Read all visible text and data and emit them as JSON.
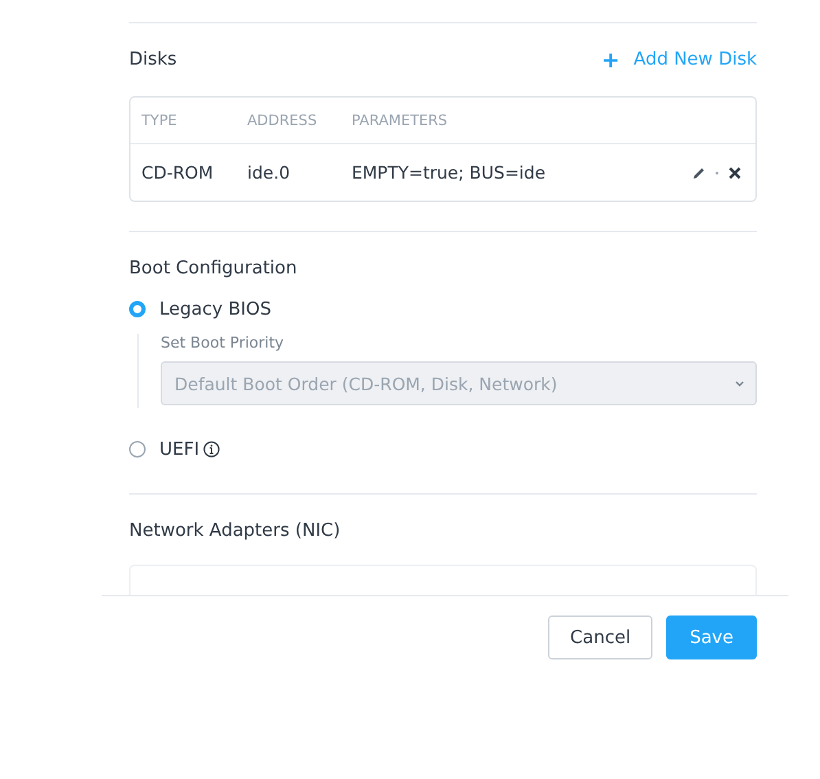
{
  "disks": {
    "title": "Disks",
    "add_action": {
      "icon": "+",
      "label": "Add New Disk"
    },
    "columns": [
      "TYPE",
      "ADDRESS",
      "PARAMETERS"
    ],
    "rows": [
      {
        "cells": [
          "CD-ROM",
          "ide.0",
          "EMPTY=true; BUS=ide"
        ]
      }
    ]
  },
  "boot": {
    "title": "Boot Configuration",
    "options": [
      {
        "label": "Legacy BIOS",
        "selected": true,
        "info": false,
        "priority": {
          "label": "Set Boot Priority",
          "value": "Default Boot Order (CD-ROM, Disk, Network)",
          "disabled": true
        }
      },
      {
        "label": "UEFI",
        "selected": false,
        "info": true
      }
    ]
  },
  "network": {
    "title": "Network Adapters (NIC)"
  },
  "buttons": [
    {
      "label": "Cancel",
      "kind": "secondary"
    },
    {
      "label": "Save",
      "kind": "primary"
    }
  ]
}
